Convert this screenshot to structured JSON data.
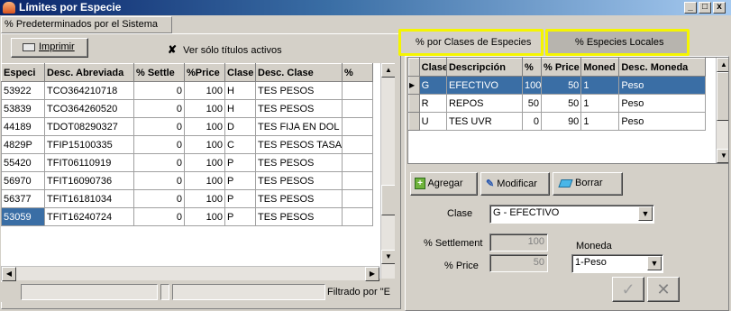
{
  "window": {
    "title": "Límites por Especie",
    "min": "_",
    "max": "□",
    "close": "x"
  },
  "left": {
    "tab_label": "% Predeterminados por el Sistema",
    "print_label": "Imprimir",
    "checkbox_checked": true,
    "checkbox_label": "Ver sólo títulos activos",
    "columns": [
      "Especi",
      "Desc. Abreviada",
      "% Settle",
      "%Price",
      "Clase",
      "Desc. Clase",
      "%"
    ],
    "rows": [
      [
        "53922",
        "TCO364210718",
        "0",
        "100",
        "H",
        "TES PESOS",
        ""
      ],
      [
        "53839",
        "TCO364260520",
        "0",
        "100",
        "H",
        "TES PESOS",
        ""
      ],
      [
        "44189",
        "TDOT08290327",
        "0",
        "100",
        "D",
        "TES FIJA EN DOL",
        ""
      ],
      [
        "4829P",
        "TFIP15100335",
        "0",
        "100",
        "C",
        "TES PESOS TASA",
        ""
      ],
      [
        "55420",
        "TFIT06110919",
        "0",
        "100",
        "P",
        "TES PESOS",
        ""
      ],
      [
        "56970",
        "TFIT16090736",
        "0",
        "100",
        "P",
        "TES PESOS",
        ""
      ],
      [
        "56377",
        "TFIT16181034",
        "0",
        "100",
        "P",
        "TES PESOS",
        ""
      ],
      [
        "53059",
        "TFIT16240724",
        "0",
        "100",
        "P",
        "TES PESOS",
        ""
      ]
    ],
    "status_text": "Filtrado por \"E"
  },
  "right": {
    "tabs": [
      "% por Clases de Especies",
      "% Especies Locales"
    ],
    "columns": [
      "Clase",
      "Descripción",
      "%",
      "% Price",
      "Moned",
      "Desc. Moneda"
    ],
    "rows": [
      [
        "G",
        "EFECTIVO",
        "100",
        "50",
        "1",
        "Peso"
      ],
      [
        "R",
        "REPOS",
        "50",
        "50",
        "1",
        "Peso"
      ],
      [
        "U",
        "TES UVR",
        "0",
        "90",
        "1",
        "Peso"
      ]
    ],
    "buttons": {
      "add": "Agregar",
      "edit": "Modificar",
      "delete": "Borrar"
    },
    "form": {
      "clase_label": "Clase",
      "clase_value": "G - EFECTIVO",
      "settlement_label": "% Settlement",
      "settlement_value": "100",
      "moneda_label": "Moneda",
      "price_label": "% Price",
      "price_value": "50",
      "moneda_value": "1-Peso"
    },
    "confirm_icon": "check-icon",
    "cancel_icon": "x-icon"
  },
  "colors": {
    "highlight": "#f5f500",
    "selection": "#3a6ea5"
  }
}
